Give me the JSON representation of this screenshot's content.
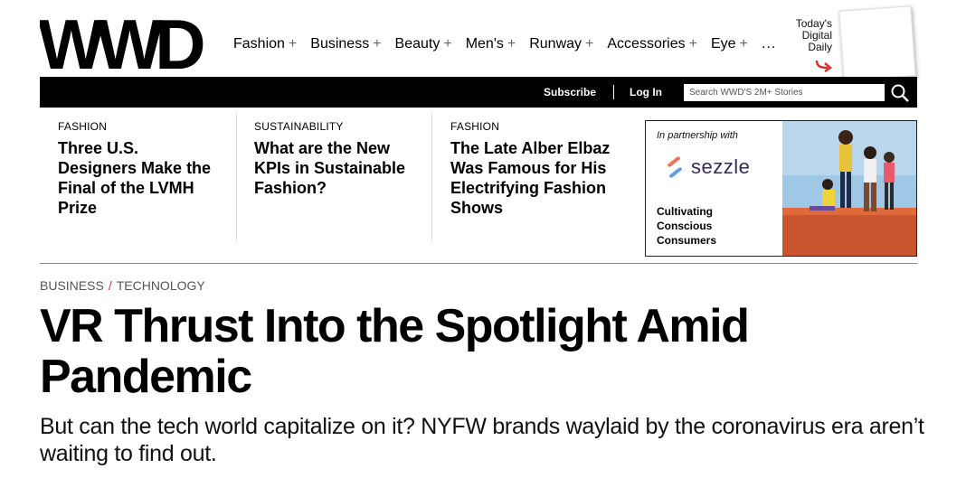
{
  "header": {
    "logo_text": "WWD",
    "nav": [
      "Fashion",
      "Business",
      "Beauty",
      "Men's",
      "Runway",
      "Accessories",
      "Eye"
    ],
    "nav_more": "...",
    "todays_digital_daily": [
      "Today's",
      "Digital",
      "Daily"
    ]
  },
  "topbar": {
    "subscribe": "Subscribe",
    "login": "Log In",
    "search_placeholder": "Search WWD'S 2M+ Stories"
  },
  "stories": [
    {
      "category": "FASHION",
      "headline": "Three U.S. Designers Make the Final of the LVMH Prize"
    },
    {
      "category": "SUSTAINABILITY",
      "headline": "What are the New KPIs in Sustainable Fashion?"
    },
    {
      "category": "FASHION",
      "headline": "The Late Alber Elbaz Was Famous for His Electrifying Fashion Shows"
    }
  ],
  "ad": {
    "partner_label": "In partnership with",
    "brand": "sezzle",
    "tagline": [
      "Cultivating",
      "Conscious",
      "Consumers"
    ]
  },
  "article": {
    "breadcrumb": [
      "BUSINESS",
      "TECHNOLOGY"
    ],
    "breadcrumb_sep": "/",
    "title": "VR Thrust Into the Spotlight Amid Pandemic",
    "dek": "But can the tech world capitalize on it? NYFW brands waylaid by the coronavirus era aren’t waiting to find out."
  },
  "colors": {
    "accent_red": "#d33333",
    "bar": "#000000"
  }
}
